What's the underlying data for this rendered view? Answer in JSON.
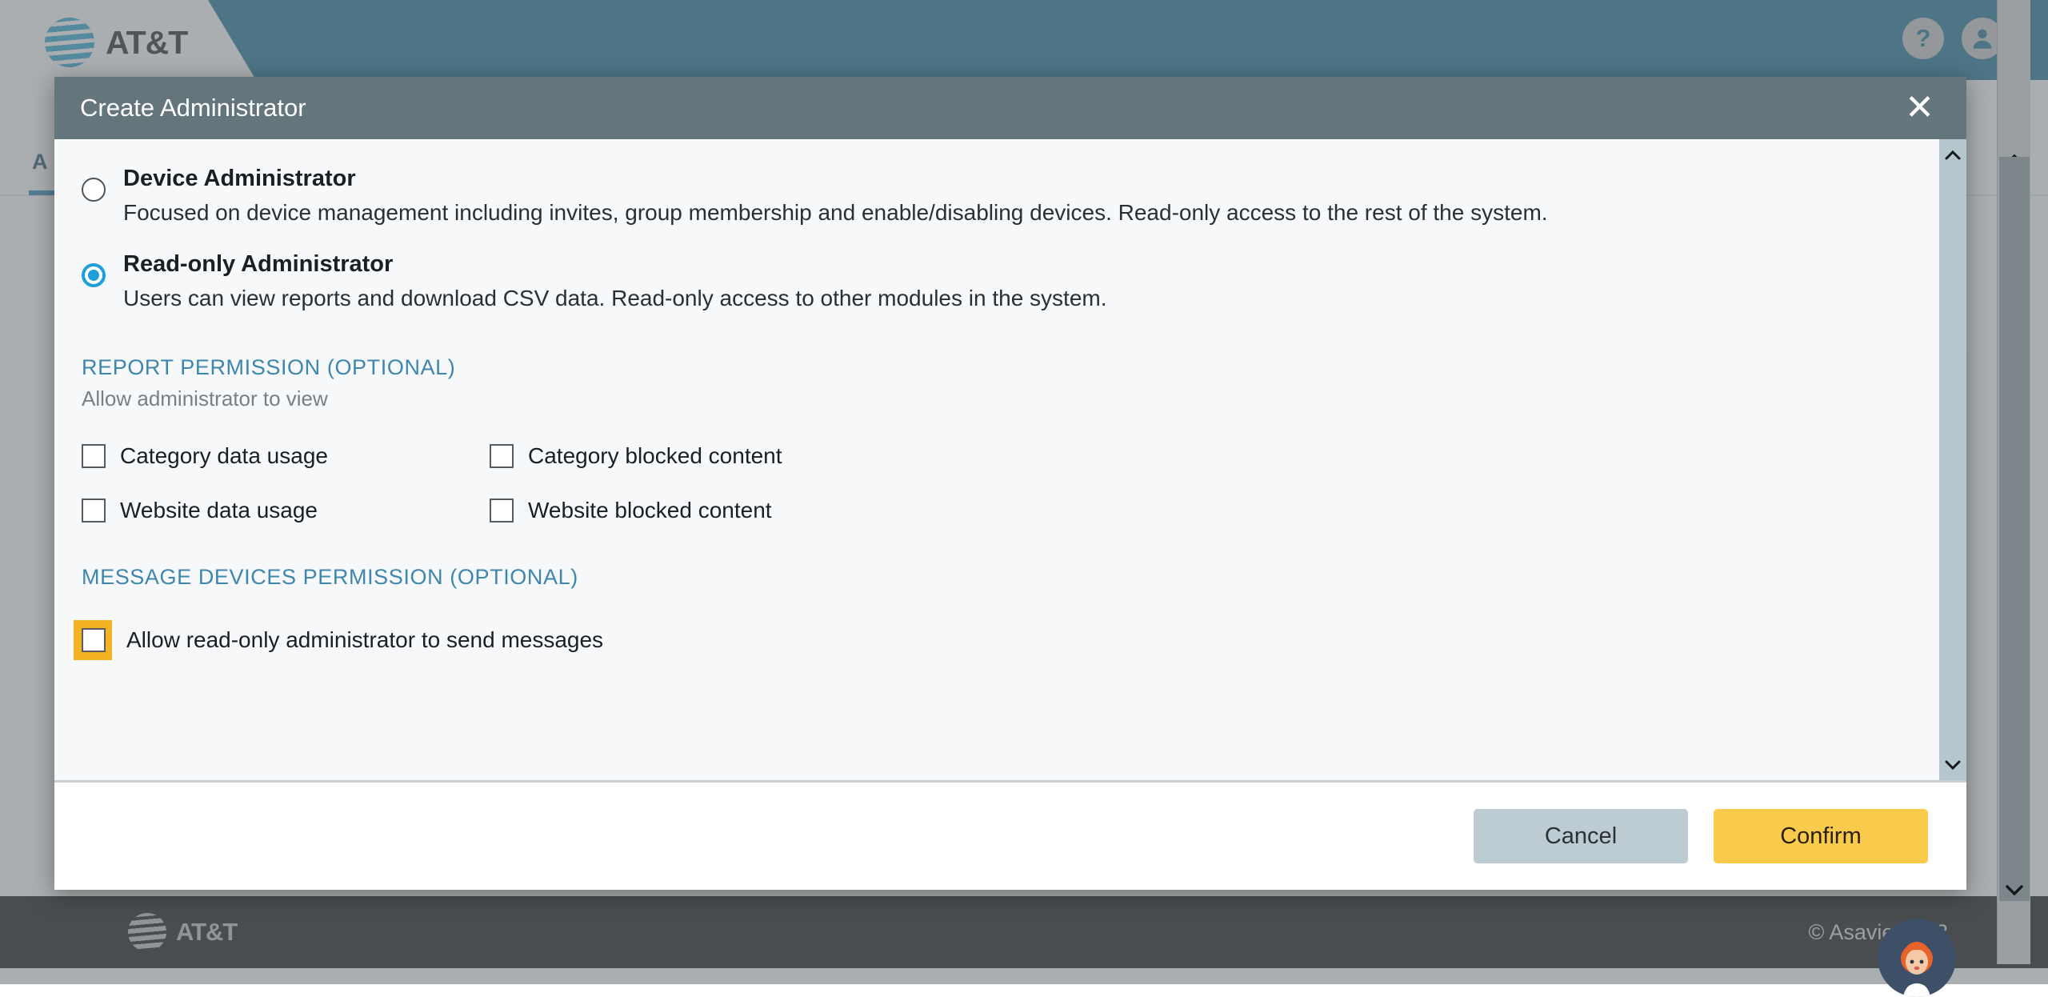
{
  "app": {
    "brand": "AT&T",
    "header_icons": [
      {
        "name": "help-icon",
        "glyph": "?"
      },
      {
        "name": "account-icon",
        "glyph": "person"
      }
    ],
    "background_tab_label": "A",
    "footer": {
      "brand": "AT&T",
      "copyright": "© Asavie 2023"
    }
  },
  "modal": {
    "title": "Create Administrator",
    "close_label": "✕",
    "roles": [
      {
        "id": "device-administrator",
        "label": "Device Administrator",
        "description": "Focused on device management including invites, group membership and enable/disabling devices. Read-only access to the rest of the system.",
        "selected": false
      },
      {
        "id": "read-only-administrator",
        "label": "Read-only Administrator",
        "description": "Users can view reports and download CSV data. Read-only access to other modules in the system.",
        "selected": true
      }
    ],
    "report_permission": {
      "title": "REPORT PERMISSION (OPTIONAL)",
      "subtitle": "Allow administrator to view",
      "options": [
        {
          "id": "category-data-usage",
          "label": "Category data usage",
          "checked": false
        },
        {
          "id": "category-blocked-content",
          "label": "Category blocked content",
          "checked": false
        },
        {
          "id": "website-data-usage",
          "label": "Website data usage",
          "checked": false
        },
        {
          "id": "website-blocked-content",
          "label": "Website blocked content",
          "checked": false
        }
      ]
    },
    "message_permission": {
      "title": "MESSAGE DEVICES PERMISSION (OPTIONAL)",
      "option": {
        "id": "allow-send-messages",
        "label": "Allow read-only administrator to send messages",
        "checked": false,
        "highlighted": true
      }
    },
    "buttons": {
      "cancel": "Cancel",
      "confirm": "Confirm"
    }
  },
  "colors": {
    "banner": "#0a6a92",
    "modal_header": "#64757c",
    "accent_blue": "#1f9fd9",
    "section_title": "#3f86ad",
    "highlight_amber": "#f5b324",
    "confirm_button": "#f9ca4b",
    "cancel_button": "#bdccd2"
  }
}
